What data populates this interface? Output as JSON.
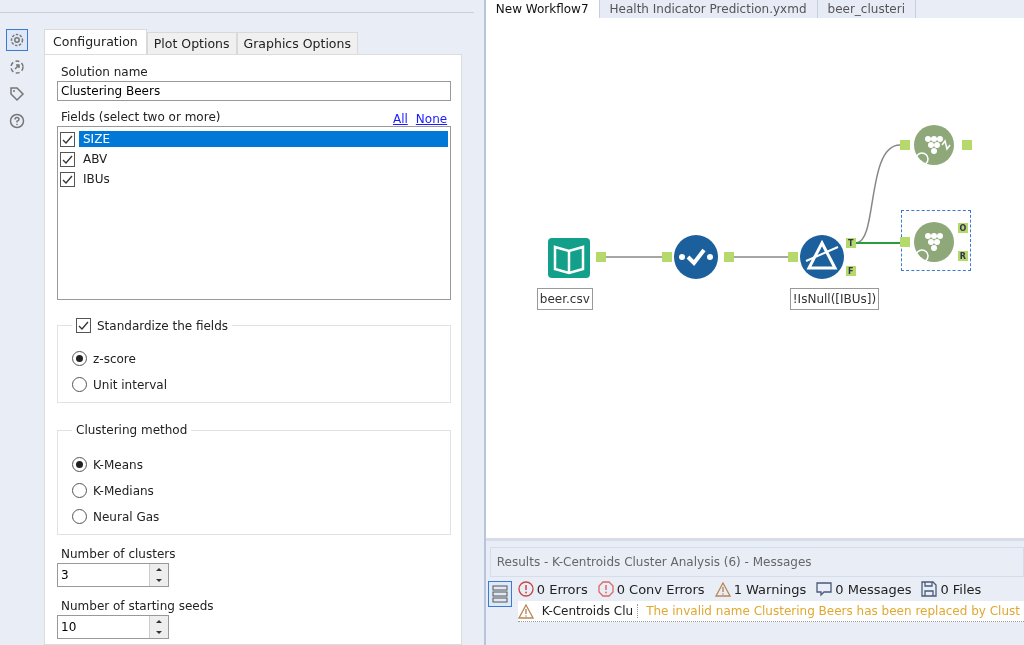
{
  "tool_icons": [
    {
      "kind": "gear",
      "selected": true
    },
    {
      "kind": "export",
      "selected": false
    },
    {
      "kind": "tag",
      "selected": false
    },
    {
      "kind": "help",
      "selected": false
    }
  ],
  "config_tabs": [
    {
      "label": "Configuration",
      "selected": true
    },
    {
      "label": "Plot Options",
      "selected": false
    },
    {
      "label": "Graphics Options",
      "selected": false
    }
  ],
  "solution_name": {
    "label": "Solution name",
    "value": "Clustering Beers"
  },
  "fields": {
    "label": "Fields (select two or more)",
    "links": [
      "All",
      "None"
    ],
    "items": [
      {
        "name": "SIZE",
        "checked": true,
        "selected": true
      },
      {
        "name": "ABV",
        "checked": true,
        "selected": false
      },
      {
        "name": "IBUs",
        "checked": true,
        "selected": false
      }
    ]
  },
  "standardize": {
    "label": "Standardize the fields",
    "checked": true,
    "options": [
      {
        "label": "z-score",
        "selected": true
      },
      {
        "label": "Unit interval",
        "selected": false
      }
    ]
  },
  "clustering_method": {
    "title": "Clustering method",
    "options": [
      {
        "label": "K-Means",
        "selected": true
      },
      {
        "label": "K-Medians",
        "selected": false
      },
      {
        "label": "Neural Gas",
        "selected": false
      }
    ]
  },
  "spinners": [
    {
      "label": "Number of clusters",
      "value": "3"
    },
    {
      "label": "Number of starting seeds",
      "value": "10"
    }
  ],
  "workflow_tabs": [
    {
      "label": "New Workflow7",
      "selected": true
    },
    {
      "label": "Health Indicator Prediction.yxmd",
      "selected": false
    },
    {
      "label": "beer_clusteri",
      "selected": false
    }
  ],
  "canvas": {
    "nodes": [
      {
        "kind": "input",
        "label": "beer.csv",
        "selected": false
      },
      {
        "kind": "select",
        "selected": false
      },
      {
        "kind": "filter",
        "label": "!IsNull([IBUs])",
        "selected": false,
        "ports": [
          "T",
          "F"
        ]
      },
      {
        "kind": "cluster_plot",
        "selected": false
      },
      {
        "kind": "cluster",
        "selected": true,
        "ports": [
          "O",
          "R"
        ]
      }
    ]
  },
  "results": {
    "title": "Results - K-Centroids Cluster Analysis (6) - Messages",
    "filters": [
      {
        "kind": "error",
        "label": "0 Errors"
      },
      {
        "kind": "conv_error",
        "label": "0 Conv Errors"
      },
      {
        "kind": "warning",
        "label": "1 Warnings"
      },
      {
        "kind": "message",
        "label": "0 Messages"
      },
      {
        "kind": "file",
        "label": "0 Files"
      }
    ],
    "rows": [
      {
        "kind": "warning",
        "tool": "K-Centroids Clu",
        "message": "The invalid name Clustering Beers has been replaced by Clust"
      }
    ]
  }
}
